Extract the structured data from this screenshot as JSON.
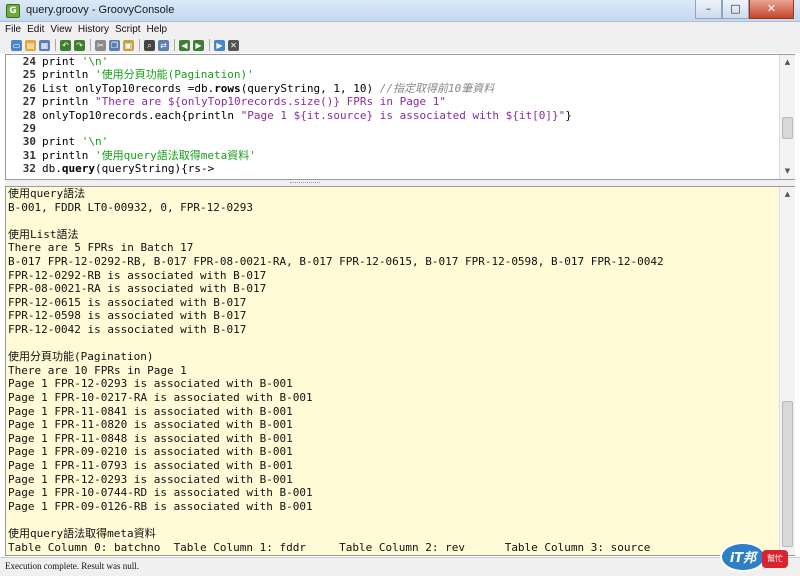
{
  "window": {
    "title": "query.groovy - GroovyConsole",
    "controls": {
      "minimize": "–",
      "maximize": "□",
      "close": "✕"
    }
  },
  "menu": [
    "File",
    "Edit",
    "View",
    "History",
    "Script",
    "Help"
  ],
  "toolbar": {
    "icons": [
      "new-file-icon",
      "open-file-icon",
      "save-icon",
      "undo-icon",
      "redo-icon",
      "cut-icon",
      "copy-icon",
      "paste-icon",
      "find-icon",
      "replace-icon",
      "history-previous-icon",
      "history-next-icon",
      "run-script-icon",
      "interrupt-icon"
    ],
    "colors": [
      "#4a84c9",
      "#e0a93a",
      "#5a7fb5",
      "#3d7f2e",
      "#3d7f2e",
      "#8a8a8a",
      "#5a7fb5",
      "#c9a044",
      "#444444",
      "#5a7fb5",
      "#3d7f2e",
      "#3d7f2e",
      "#4a84c9",
      "#555555"
    ]
  },
  "editor": {
    "lines": [
      {
        "num": "24",
        "parts": [
          [
            "p",
            "print "
          ],
          [
            "s",
            "'\\n'"
          ]
        ]
      },
      {
        "num": "25",
        "parts": [
          [
            "p",
            "println "
          ],
          [
            "s",
            "'使用分頁功能(Pagination)'"
          ]
        ]
      },
      {
        "num": "26",
        "parts": [
          [
            "p",
            "List onlyTop10records =db."
          ],
          [
            "k",
            "rows"
          ],
          [
            "p",
            "(queryString, 1, 10) "
          ],
          [
            "c",
            "//指定取得前10筆資料"
          ]
        ]
      },
      {
        "num": "27",
        "parts": [
          [
            "p",
            "println "
          ],
          [
            "g",
            "\"There are ${onlyTop10records.size()} FPRs in Page 1\""
          ]
        ]
      },
      {
        "num": "28",
        "parts": [
          [
            "p",
            "onlyTop10records.each{println "
          ],
          [
            "g",
            "\"Page 1 ${it.source} is associated with ${it[0]}\""
          ],
          [
            "p",
            "}"
          ]
        ]
      },
      {
        "num": "29",
        "parts": []
      },
      {
        "num": "30",
        "parts": [
          [
            "p",
            "print "
          ],
          [
            "s",
            "'\\n'"
          ]
        ]
      },
      {
        "num": "31",
        "parts": [
          [
            "p",
            "println "
          ],
          [
            "s",
            "'使用query語法取得meta資料'"
          ]
        ]
      },
      {
        "num": "32",
        "parts": [
          [
            "p",
            "db."
          ],
          [
            "k",
            "query"
          ],
          [
            "p",
            "(queryString){rs->"
          ]
        ]
      }
    ]
  },
  "output": {
    "lines": [
      "使用query語法",
      "B-001, FDDR LT0-00932, 0, FPR-12-0293",
      "",
      "使用List語法",
      "There are 5 FPRs in Batch 17",
      "B-017 FPR-12-0292-RB, B-017 FPR-08-0021-RA, B-017 FPR-12-0615, B-017 FPR-12-0598, B-017 FPR-12-0042",
      "FPR-12-0292-RB is associated with B-017",
      "FPR-08-0021-RA is associated with B-017",
      "FPR-12-0615 is associated with B-017",
      "FPR-12-0598 is associated with B-017",
      "FPR-12-0042 is associated with B-017",
      "",
      "使用分頁功能(Pagination)",
      "There are 10 FPRs in Page 1",
      "Page 1 FPR-12-0293 is associated with B-001",
      "Page 1 FPR-10-0217-RA is associated with B-001",
      "Page 1 FPR-11-0841 is associated with B-001",
      "Page 1 FPR-11-0820 is associated with B-001",
      "Page 1 FPR-11-0848 is associated with B-001",
      "Page 1 FPR-09-0210 is associated with B-001",
      "Page 1 FPR-11-0793 is associated with B-001",
      "Page 1 FPR-12-0293 is associated with B-001",
      "Page 1 FPR-10-0744-RD is associated with B-001",
      "Page 1 FPR-09-0126-RB is associated with B-001",
      "",
      "使用query語法取得meta資料",
      "Table Column 0: batchno  Table Column 1: fddr     Table Column 2: rev      Table Column 3: source"
    ]
  },
  "status": {
    "text": "Execution complete. Result was null."
  },
  "watermark": {
    "badge": "iT邦",
    "tag": "幫忙"
  }
}
